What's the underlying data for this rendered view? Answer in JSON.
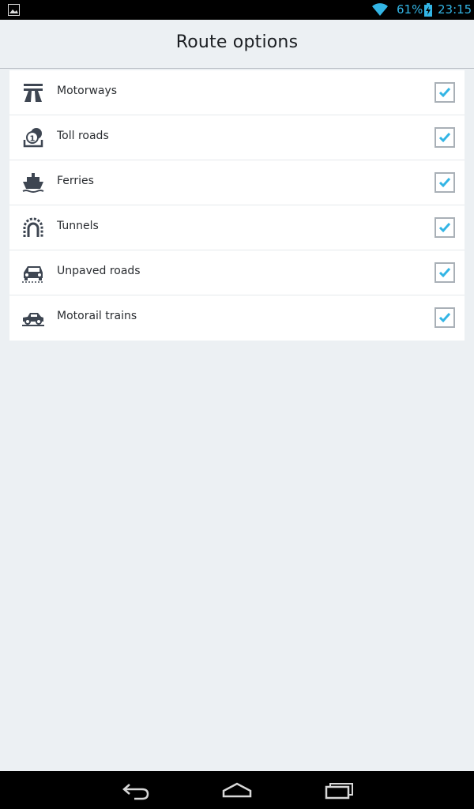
{
  "status_bar": {
    "battery_percent": "61%",
    "time": "23:15",
    "accent_color": "#33b5e5"
  },
  "header": {
    "title": "Route options"
  },
  "options": [
    {
      "label": "Motorways",
      "icon": "motorway-icon",
      "checked": true
    },
    {
      "label": "Toll roads",
      "icon": "toll-road-icon",
      "checked": true
    },
    {
      "label": "Ferries",
      "icon": "ferry-icon",
      "checked": true
    },
    {
      "label": "Tunnels",
      "icon": "tunnel-icon",
      "checked": true
    },
    {
      "label": "Unpaved roads",
      "icon": "unpaved-road-icon",
      "checked": true
    },
    {
      "label": "Motorail trains",
      "icon": "motorail-train-icon",
      "checked": true
    }
  ],
  "colors": {
    "background": "#ecf0f3",
    "check": "#33b5e5",
    "icon": "#3e4652"
  },
  "nav_bar": {
    "buttons": [
      "back-icon",
      "home-icon",
      "recent-apps-icon"
    ]
  }
}
